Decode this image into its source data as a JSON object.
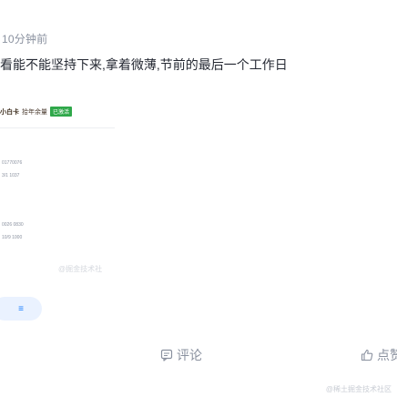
{
  "post": {
    "time": "10分钟前",
    "text": "看能不能坚持下来,拿着微薄,节前的最后一个工作日"
  },
  "card": {
    "brand": "小白卡",
    "subtitle": "拾年余量",
    "badge": "已激活",
    "lines": [
      {
        "text": "01770076"
      },
      {
        "text": "3/1 1037"
      },
      {
        "text": "·"
      },
      {
        "text": "0026 0830"
      },
      {
        "text": "10/9 1000"
      },
      {
        "text": "·"
      }
    ],
    "watermark": "@掘金技术社"
  },
  "tag": {
    "label": "≡"
  },
  "actions": {
    "comment_label": "评论",
    "like_label": "点赞",
    "comment_icon": "comment-icon",
    "like_icon": "thumb-up-icon"
  },
  "footer": {
    "watermark": "@稀土掘金技术社区"
  }
}
